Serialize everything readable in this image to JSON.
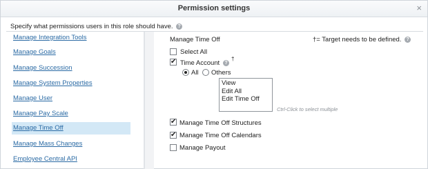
{
  "dialog": {
    "title": "Permission settings",
    "close_icon": "×",
    "instruction": "Specify what permissions users in this role should have.",
    "help_icon": "?"
  },
  "sidebar": {
    "items": [
      {
        "label": "Manage Integration Tools",
        "active": false
      },
      {
        "label": "Manage Goals",
        "active": false
      },
      {
        "label": "Manage Succession",
        "active": false
      },
      {
        "label": "Manage System Properties",
        "active": false
      },
      {
        "label": "Manage User",
        "active": false
      },
      {
        "label": "Manage Pay Scale",
        "active": false
      },
      {
        "label": "Manage Time Off",
        "active": true
      },
      {
        "label": "Manage Mass Changes",
        "active": false
      },
      {
        "label": "Employee Central API",
        "active": false
      }
    ]
  },
  "main": {
    "heading": "Manage Time Off",
    "target_note": "†= Target needs to be defined.",
    "select_all": {
      "label": "Select All",
      "checked": false
    },
    "time_account": {
      "label": "Time Account",
      "dagger": "†",
      "checked": true,
      "radio_all": {
        "label": "All",
        "selected": true
      },
      "radio_others": {
        "label": "Others",
        "selected": false
      },
      "options": [
        "View",
        "Edit All",
        "Edit Time Off"
      ],
      "hint": "Ctrl-Click to select multiple"
    },
    "permissions": [
      {
        "label": "Manage Time Off Structures",
        "checked": true
      },
      {
        "label": "Manage Time Off Calendars",
        "checked": true
      },
      {
        "label": "Manage Payout",
        "checked": false
      }
    ]
  },
  "icons": {
    "close": "close-icon",
    "help": "help-icon"
  },
  "colors": {
    "link": "#2a6aa4",
    "active_row": "#d3e8f6"
  }
}
